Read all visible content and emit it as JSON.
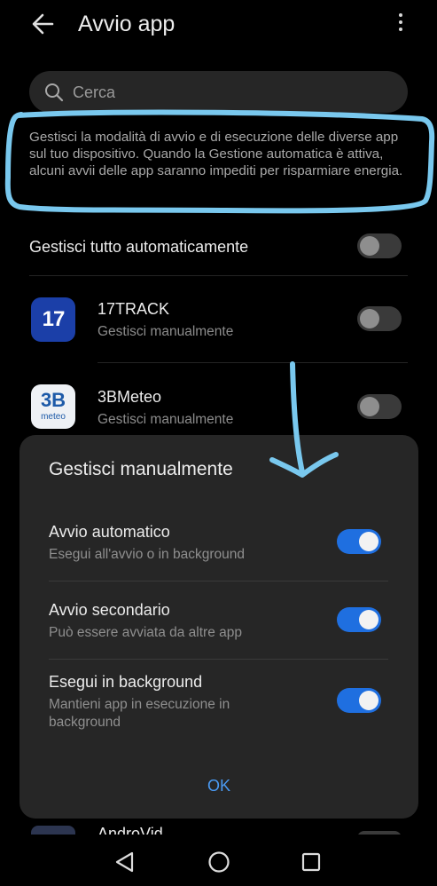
{
  "header": {
    "title": "Avvio app"
  },
  "search": {
    "placeholder": "Cerca"
  },
  "description": "Gestisci la modalità di avvio e di esecuzione delle diverse app sul tuo dispositivo. Quando la Gestione automatica è attiva, alcuni avvii delle app saranno impediti per risparmiare energia.",
  "manage_all": {
    "label": "Gestisci tutto automaticamente",
    "enabled": false
  },
  "apps": [
    {
      "name": "17TRACK",
      "status": "Gestisci manualmente",
      "enabled": false,
      "icon_text": "17"
    },
    {
      "name": "3BMeteo",
      "status": "Gestisci manualmente",
      "enabled": false,
      "icon_text": "3B",
      "icon_subtext": "meteo"
    },
    {
      "name": "AndroVid",
      "status": "",
      "enabled": false
    }
  ],
  "dialog": {
    "title": "Gestisci manualmente",
    "options": [
      {
        "title": "Avvio automatico",
        "subtitle": "Esegui all'avvio o in background",
        "enabled": true
      },
      {
        "title": "Avvio secondario",
        "subtitle": "Può essere avviata da altre app",
        "enabled": true
      },
      {
        "title": "Esegui in background",
        "subtitle": "Mantieni app in esecuzione in background",
        "enabled": true
      }
    ],
    "ok_label": "OK"
  },
  "colors": {
    "accent": "#1f6fe0",
    "annotation": "#79c8ee",
    "background": "#000000",
    "sheet": "#262626"
  },
  "icons": [
    "back-arrow-icon",
    "more-vert-icon",
    "search-icon",
    "nav-back-icon",
    "nav-home-icon",
    "nav-recents-icon"
  ]
}
